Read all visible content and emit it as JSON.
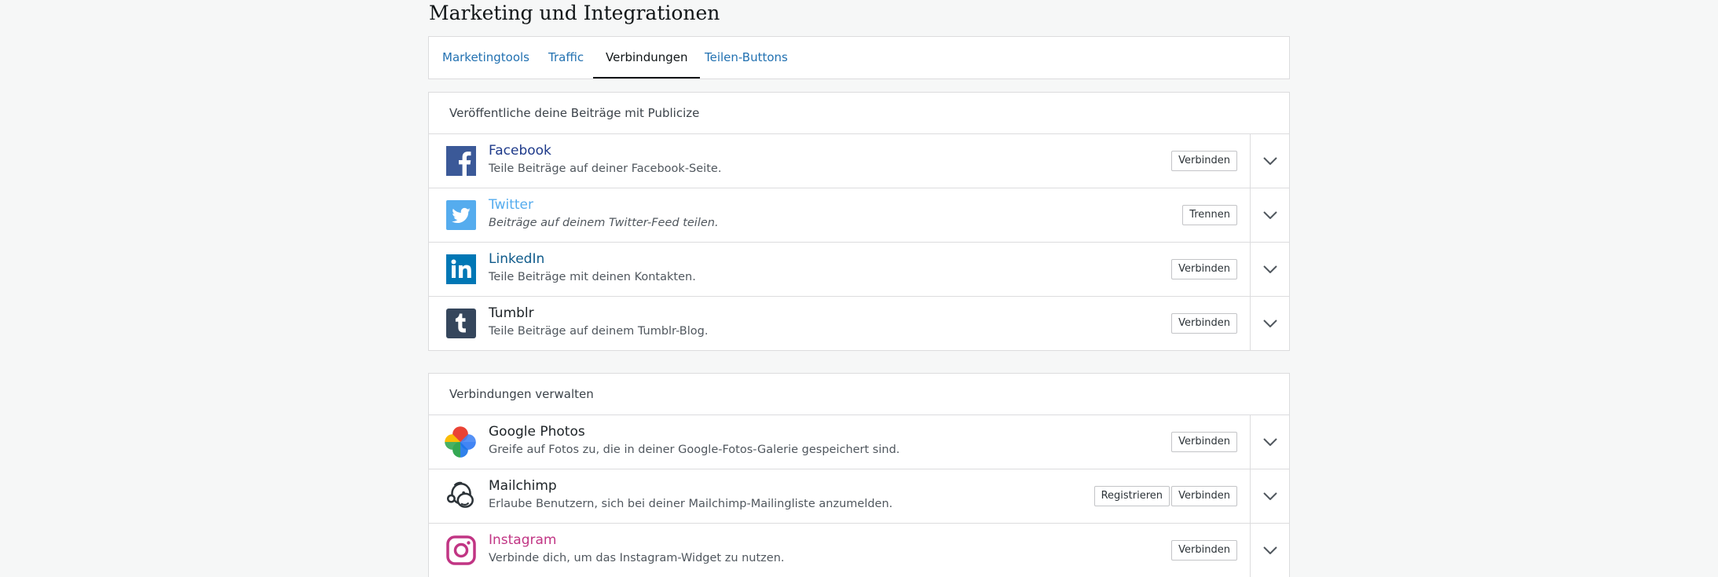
{
  "page": {
    "title": "Marketing und Integrationen"
  },
  "tabs": [
    {
      "label": "Marketingtools"
    },
    {
      "label": "Traffic"
    },
    {
      "label": "Verbindungen",
      "active": true
    },
    {
      "label": "Teilen-Buttons"
    }
  ],
  "publicize": {
    "header": "Veröffentliche deine Beiträge mit Publicize",
    "services": [
      {
        "name": "Facebook",
        "description": "Teile Beiträge auf deiner Facebook-Seite.",
        "button": "Verbinden",
        "name_color": "#1e3a8a",
        "icon": "facebook-icon"
      },
      {
        "name": "Twitter",
        "description": "Beiträge auf deinem Twitter-Feed teilen.",
        "button": "Trennen",
        "name_color": "#55acee",
        "icon": "twitter-icon"
      },
      {
        "name": "LinkedIn",
        "description": "Teile Beiträge mit deinen Kontakten.",
        "button": "Verbinden",
        "name_color": "#0e5a8a",
        "icon": "linkedin-icon"
      },
      {
        "name": "Tumblr",
        "description": "Teile Beiträge auf deinem Tumblr-Blog.",
        "button": "Verbinden",
        "name_color": "#1d2327",
        "icon": "tumblr-icon"
      }
    ]
  },
  "manage": {
    "header": "Verbindungen verwalten",
    "services": [
      {
        "name": "Google Photos",
        "description": "Greife auf Fotos zu, die in deiner Google-Fotos-Galerie gespeichert sind.",
        "button": "Verbinden",
        "name_color": "#1d2327",
        "icon": "google-photos-icon"
      },
      {
        "name": "Mailchimp",
        "description": "Erlaube Benutzern, sich bei deiner Mailchimp-Mailingliste anzumelden.",
        "button": "Verbinden",
        "secondary_button": "Registrieren",
        "name_color": "#1d2327",
        "icon": "mailchimp-icon"
      },
      {
        "name": "Instagram",
        "description": "Verbinde dich, um das Instagram-Widget zu nutzen.",
        "button": "Verbinden",
        "name_color": "#c13584",
        "icon": "instagram-icon"
      }
    ]
  },
  "colors": {
    "link": "#2271b1",
    "facebook": "#3b5998",
    "twitter": "#55acee",
    "linkedin": "#0077b5",
    "tumblr": "#35465c",
    "instagram": "#c13584"
  }
}
